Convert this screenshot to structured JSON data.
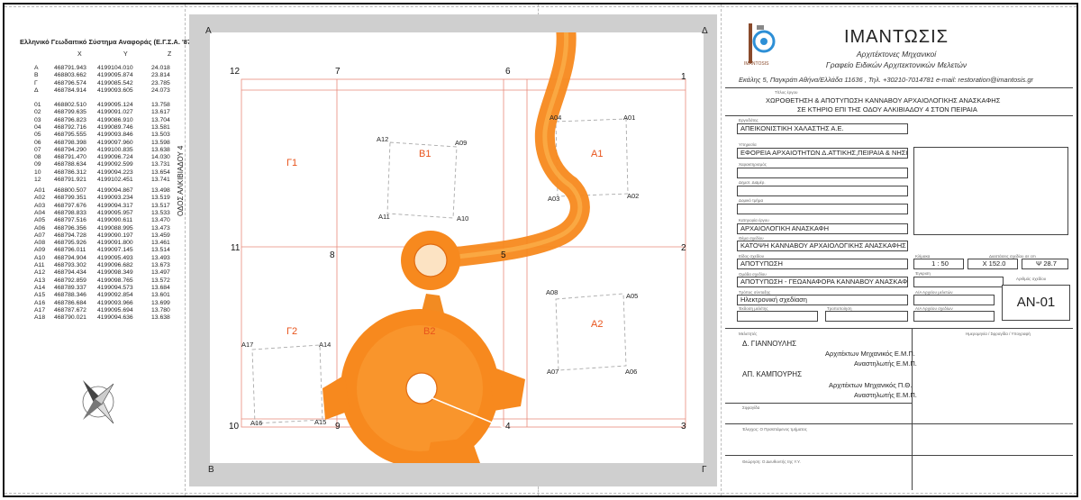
{
  "coordinate_table": {
    "title": "Ελληνικό Γεωδαιτικό Σύστημα Αναφοράς (Ε.Γ.Σ.Α. '87)",
    "headers": [
      "X",
      "Y",
      "Z"
    ],
    "groups": [
      [
        [
          "A",
          "468791.943",
          "4199104.010",
          "24.018"
        ],
        [
          "B",
          "468803.662",
          "4199095.874",
          "23.814"
        ],
        [
          "Γ",
          "468796.574",
          "4199085.542",
          "23.785"
        ],
        [
          "Δ",
          "468784.914",
          "4199093.605",
          "24.073"
        ]
      ],
      [
        [
          "01",
          "468802.510",
          "4199095.124",
          "13.758"
        ],
        [
          "02",
          "468799.635",
          "4199091.027",
          "13.617"
        ],
        [
          "03",
          "468796.823",
          "4199086.910",
          "13.704"
        ],
        [
          "04",
          "468792.716",
          "4199089.746",
          "13.581"
        ],
        [
          "05",
          "468795.555",
          "4199093.846",
          "13.503"
        ],
        [
          "06",
          "468798.398",
          "4199097.960",
          "13.598"
        ],
        [
          "07",
          "468794.290",
          "4199100.835",
          "13.638"
        ],
        [
          "08",
          "468791.470",
          "4199096.724",
          "14.030"
        ],
        [
          "09",
          "468788.634",
          "4199092.599",
          "13.731"
        ],
        [
          "10",
          "468786.312",
          "4199094.223",
          "13.654"
        ],
        [
          "12",
          "468791.921",
          "4199102.451",
          "13.741"
        ]
      ],
      [
        [
          "A01",
          "468800.507",
          "4199094.867",
          "13.498"
        ],
        [
          "A02",
          "468799.351",
          "4199093.234",
          "13.519"
        ],
        [
          "A03",
          "468797.676",
          "4199094.317",
          "13.517"
        ],
        [
          "A04",
          "468798.833",
          "4199095.957",
          "13.533"
        ],
        [
          "A05",
          "468797.516",
          "4199090.611",
          "13.470"
        ],
        [
          "A06",
          "468796.356",
          "4199088.995",
          "13.473"
        ],
        [
          "A07",
          "468794.728",
          "4199090.197",
          "13.459"
        ],
        [
          "A08",
          "468795.926",
          "4199091.800",
          "13.461"
        ],
        [
          "A09",
          "468796.011",
          "4199097.145",
          "13.514"
        ],
        [
          "A10",
          "468794.904",
          "4199095.493",
          "13.493"
        ],
        [
          "A11",
          "468793.302",
          "4199096.682",
          "13.673"
        ],
        [
          "A12",
          "468794.434",
          "4199098.349",
          "13.497"
        ],
        [
          "A13",
          "468792.859",
          "4199098.765",
          "13.572"
        ],
        [
          "A14",
          "468789.337",
          "4199094.573",
          "13.684"
        ],
        [
          "A15",
          "468788.346",
          "4199092.854",
          "13.601"
        ],
        [
          "A16",
          "468786.684",
          "4199093.966",
          "13.699"
        ],
        [
          "A17",
          "468787.672",
          "4199095.694",
          "13.780"
        ],
        [
          "A18",
          "468790.021",
          "4199094.636",
          "13.638"
        ]
      ]
    ]
  },
  "plan": {
    "corner_labels": {
      "top_left": "A",
      "top_right": "Δ",
      "bottom_left": "B",
      "bottom_right": "Γ"
    },
    "street_label": "ΟΔΟΣ ΑΛΚΙΒΙΑΔΟΥ 4",
    "grid_labels": [
      "12",
      "7",
      "6",
      "1",
      "11",
      "8",
      "5",
      "2",
      "10",
      "9",
      "4",
      "3"
    ],
    "zone_labels": [
      "Γ1",
      "Β1",
      "Α1",
      "Γ2",
      "Β2",
      "Α2"
    ],
    "point_labels": [
      "A04",
      "A01",
      "A03",
      "A02",
      "A12",
      "A09",
      "A11",
      "A10",
      "A08",
      "A05",
      "A07",
      "A06",
      "A17",
      "A14",
      "A16",
      "A15"
    ],
    "colors": {
      "canal": "#f7891e",
      "zone_label": "#e8541c",
      "grid": "#e88a7a"
    }
  },
  "title_block": {
    "firm_name": "ΙΜΑΝΤΩΣΙΣ",
    "firm_sub1": "Αρχιτέκτονες Μηχανικοί",
    "firm_sub2": "Γραφείο Ειδικών Αρχιτεκτονικών Μελετών",
    "logo_text": "IMANTOSIS",
    "address": "Εκάλης 5, Παγκράτι  Αθήνα/Ελλάδα 11636 , Τηλ. +30210-7014781    e-mail: restoration@imantosis.gr",
    "labels": {
      "work_title": "Τίτλος έργου",
      "client": "Εργοδότης",
      "service": "Υπηρεσία",
      "location": "Χαρακτηρισμός",
      "municipality": "Δημοτ. Διαμέρ.",
      "block": "Δομικό τμήμα",
      "category": "Κατηγορία έργου",
      "drawing_title": "Θέμα σχεδίου",
      "scale": "Κλίμακα",
      "dimensions": "Διαστάσεις σχεδίου σε cm",
      "drawing_type": "Είδος σχεδίου",
      "edition": "Έγκριση",
      "drawing_group": "Ομάδα σχεδίου",
      "drawing_no": "Αριθμός σχεδίου",
      "method": "Τρόπος σύνταξης",
      "ap_number_study": "Α/Α Αρχείου μελετών",
      "edition_date": "Έκδοση μελέτης",
      "revision": "Τροποποίηση",
      "ap_number_drawing": "Α/Α Αρχείου σχεδίων",
      "designers": "Μελετητές",
      "date_signature": "Ημερομηνία / Σφραγίδα / Υπογραφή",
      "signature": "Σφραγίδα",
      "check": "Έλεγχος: Ο Προϊστάμενος τμήματος",
      "approval": "Θεώρηση: Ο Διευθυντής της Υ.Υ."
    },
    "work_title_line1": "ΧΩΡΟΘΕΤΗΣΗ & ΑΠΟΤΥΠΩΣΗ ΚΑΝΝΑΒΟΥ ΑΡΧΑΙΟΛΟΓΙΚΗΣ ΑΝΑΣΚΑΦΗΣ",
    "work_title_line2": "ΣΕ ΚΤΗΡΙΟ ΕΠΙ ΤΗΣ ΟΔΟΥ ΑΛΚΙΒΙΑΔΟΥ 4 ΣΤΟΝ ΠΕΙΡΑΙΑ",
    "client": "ΑΠΕΙΚΟΝΙΣΤΙΚΗ ΧΑΛΑΣΤΗΣ Α.Ε.",
    "service": "ΕΦΟΡΕΙΑ ΑΡΧΑΙΟΤΗΤΩΝ Δ.ΑΤΤΙΚΗΣ,ΠΕΙΡΑΙΑ & ΝΗΣΩΝ",
    "category": "ΑΡΧΑΙΟΛΟΓΙΚΗ ΑΝΑΣΚΑΦΗ",
    "drawing_title": "ΚΑΤΟΨΗ ΚΑΝΝΑΒΟΥ ΑΡΧΑΙΟΛΟΓΙΚΗΣ ΑΝΑΣΚΑΦΗΣ",
    "drawing_type": "ΑΠΟΤΥΠΩΣΗ",
    "scale": "1 : 50",
    "dim_x": "Χ  152.0",
    "dim_y": "Ψ  28.7",
    "drawing_group": "ΑΠΟΤΥΠΩΣΗ - ΓΕΩΑΝΑΦΟΡΑ ΚΑΝΝΑΒΟΥ ΑΝΑΣΚΑΦΗΣ",
    "method": "Ηλεκτρονική σχεδίαση",
    "drawing_no": "ΑΝ-01",
    "designer1_name": "Δ. ΓΙΑΝΝΟΥΛΗΣ",
    "designer1_role1": "Αρχιτέκτων Μηχανικός Ε.Μ.Π.",
    "designer1_role2": "Αναστηλωτής Ε.Μ.Π.",
    "designer2_name": "ΑΠ. ΚΑΜΠΟΥΡΗΣ",
    "designer2_role1": "Αρχιτέκτων Μηχανικός Π.Θ.",
    "designer2_role2": "Αναστηλωτής Ε.Μ.Π."
  }
}
